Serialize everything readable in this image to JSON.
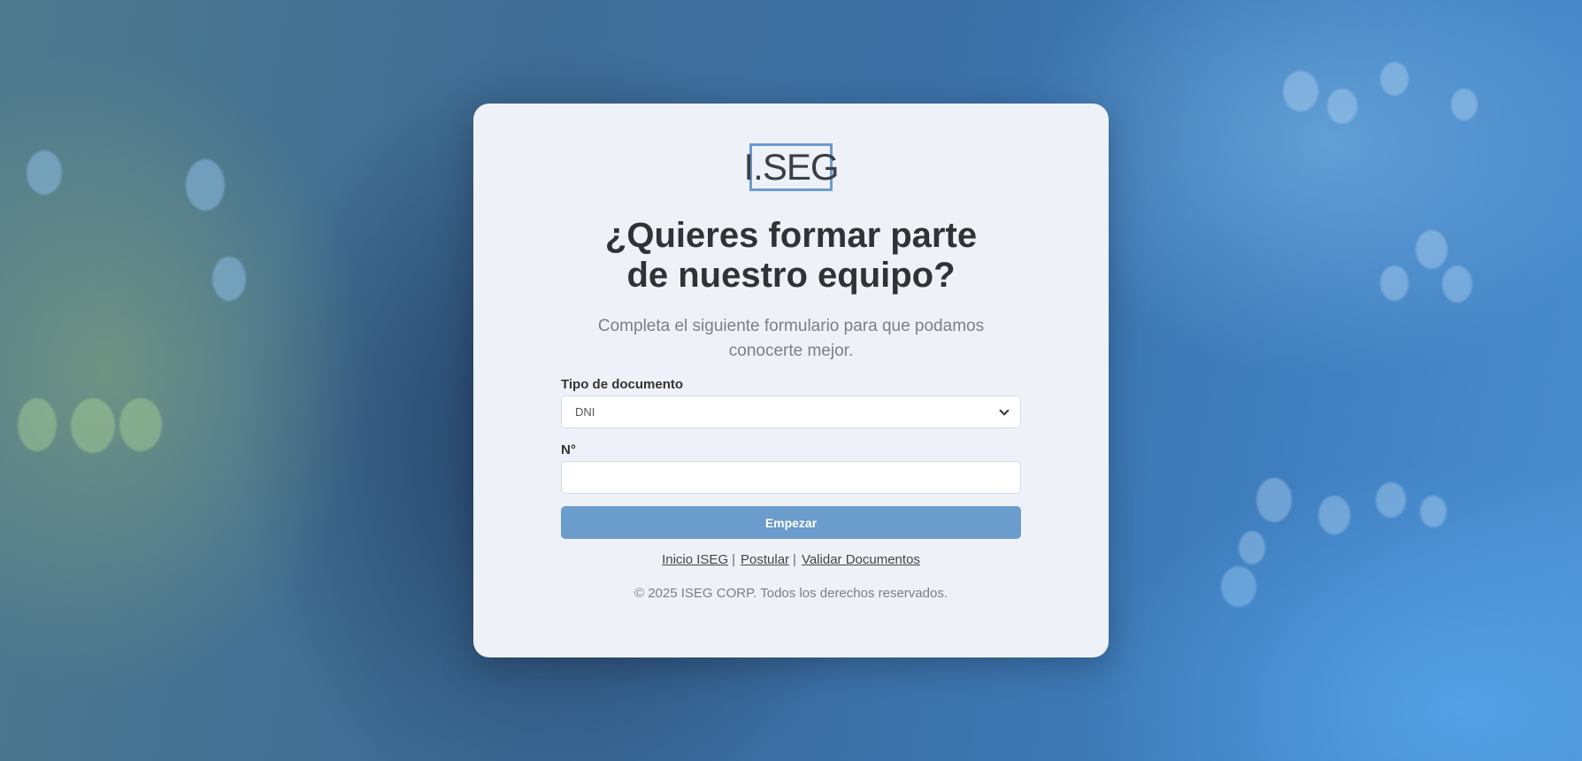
{
  "logo": {
    "text": "I.SEG"
  },
  "header": {
    "title_line1": "¿Quieres formar parte",
    "title_line2": "de nuestro equipo?",
    "subtitle_line1": "Completa el siguiente formulario para que podamos",
    "subtitle_line2": "conocerte mejor."
  },
  "form": {
    "doc_type_label": "Tipo de documento",
    "doc_type_value": "DNI",
    "number_label": "N°",
    "number_value": "",
    "submit_label": "Empezar"
  },
  "footer": {
    "links": [
      "Inicio ISEG",
      "Postular",
      "Validar Documentos"
    ],
    "separator": "|",
    "copyright": "© 2025 ISEG CORP. Todos los derechos reservados."
  },
  "colors": {
    "accent": "#6a9ccc",
    "logo_border": "#6b9bd0",
    "card_bg": "#eef2f8",
    "title": "#2f3337",
    "muted": "#7a7f86"
  },
  "icons": {
    "select_chevron": "chevron-down-icon"
  }
}
